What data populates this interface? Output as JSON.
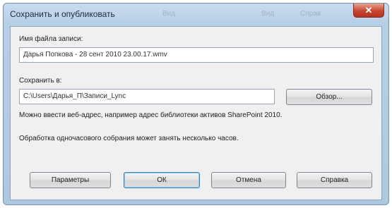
{
  "dialog": {
    "title": "Сохранить и опубликовать",
    "background_title_fragments": [
      "Вид",
      "Вид",
      "Справ"
    ],
    "close_symbol": "✕",
    "file_name_label": "Имя файла записи:",
    "file_name_value": "Дарья Попкова - 28 сент 2010 23.00.17.wmv",
    "save_to_label": "Сохранить в:",
    "save_to_value": "C:\\Users\\Дарья_П\\Записи_Lync",
    "browse_button": "Обзор...",
    "hint_text": "Можно ввести веб-адрес, например адрес библиотеки активов SharePoint 2010.",
    "processing_text": "Обработка одночасового собрания может занять несколько часов.",
    "buttons": {
      "options": "Параметры",
      "ok": "ОК",
      "cancel": "Отмена",
      "help": "Справка"
    }
  },
  "colors": {
    "titlebar": "#b7cfe6",
    "close_button": "#c7452f",
    "client_background": "#f0f0f0",
    "default_button_border": "#3c7fb1"
  }
}
